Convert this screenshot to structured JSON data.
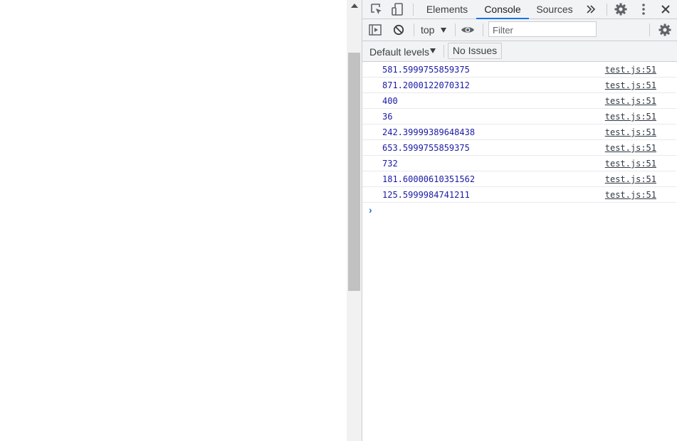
{
  "tabs": {
    "elements": "Elements",
    "console": "Console",
    "sources": "Sources"
  },
  "toolbar": {
    "context": "top",
    "filter_placeholder": "Filter",
    "levels": "Default levels",
    "issues": "No Issues"
  },
  "console": {
    "messages": [
      {
        "value": "581.5999755859375",
        "source": "test.js:51"
      },
      {
        "value": "871.2000122070312",
        "source": "test.js:51"
      },
      {
        "value": "400",
        "source": "test.js:51"
      },
      {
        "value": "36",
        "source": "test.js:51"
      },
      {
        "value": "242.39999389648438",
        "source": "test.js:51"
      },
      {
        "value": "653.5999755859375",
        "source": "test.js:51"
      },
      {
        "value": "732",
        "source": "test.js:51"
      },
      {
        "value": "181.60000610351562",
        "source": "test.js:51"
      },
      {
        "value": "125.5999984741211",
        "source": "test.js:51"
      }
    ]
  },
  "colors": {
    "accent": "#1a73e8",
    "number_value": "#1a1aa6",
    "toolbar_bg": "#f1f3f4"
  },
  "icons": {
    "inspect": "inspect-element-icon",
    "device": "device-toolbar-icon",
    "more_tabs": "more-tabs-icon",
    "settings": "gear-icon",
    "menu": "kebab-menu-icon",
    "close": "close-icon",
    "sidebar": "sidebar-toggle-icon",
    "clear": "clear-console-icon",
    "live": "eye-icon",
    "console_settings": "gear-icon",
    "prompt": "prompt-chevron-icon"
  }
}
